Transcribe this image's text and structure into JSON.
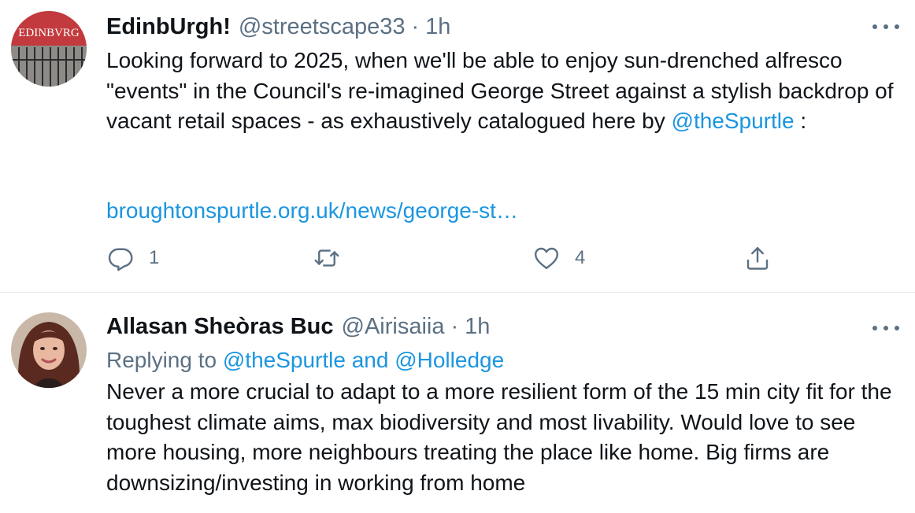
{
  "tweets": [
    {
      "display_name": "EdinbUrgh!",
      "handle": "@streetscape33",
      "separator": "·",
      "time": "1h",
      "avatar_text": "EDINBVRG",
      "text_before": "Looking forward to 2025, when we'll be able to enjoy sun-drenched alfresco \"events\" in the Council's re-imagined George Street against a stylish backdrop of vacant retail spaces - as exhaustively catalogued here by ",
      "mention": "@theSpurtle",
      "text_after": " :",
      "link": "broughtonspurtle.org.uk/news/george-st…",
      "reply_count": "1",
      "retweet_count": "",
      "like_count": "4"
    },
    {
      "display_name": "Allasan Sheòras Buc",
      "handle": "@Airisaiia",
      "separator": "·",
      "time": "1h",
      "replying_prefix": "Replying to ",
      "replying_to": "@theSpurtle and @Holledge",
      "text": "Never a more crucial to adapt to a more resilient form of the 15 min city fit for the toughest climate aims, max biodiversity and most livability. Would love to see more housing, more neighbours treating the place like home. Big firms are downsizing/investing in working from home"
    }
  ],
  "icons": {
    "reply": "reply-icon",
    "retweet": "retweet-icon",
    "like": "heart-icon",
    "share": "share-icon",
    "more": "more-icon"
  },
  "colors": {
    "link": "#1b95e0",
    "secondary_text": "#5b7083",
    "primary_text": "#0f1419",
    "divider": "#e6ecf0"
  }
}
